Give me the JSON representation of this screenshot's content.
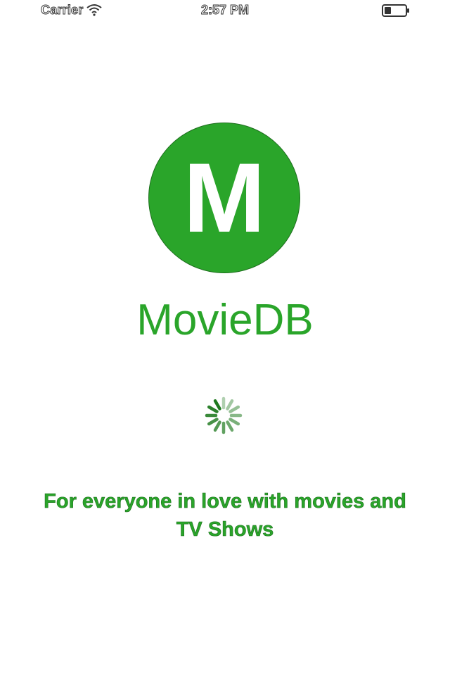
{
  "status_bar": {
    "carrier": "Carrier",
    "time": "2:57 PM",
    "wifi_icon": "wifi-icon",
    "battery_icon": "battery-icon"
  },
  "splash": {
    "logo_letter": "M",
    "app_name": "MovieDB",
    "tagline": "For everyone in love with movies and TV Shows",
    "spinner_icon": "activity-indicator-icon"
  },
  "colors": {
    "brand_green": "#2aa52a",
    "spinner_green": "#1f7a1f",
    "background": "#ffffff"
  }
}
